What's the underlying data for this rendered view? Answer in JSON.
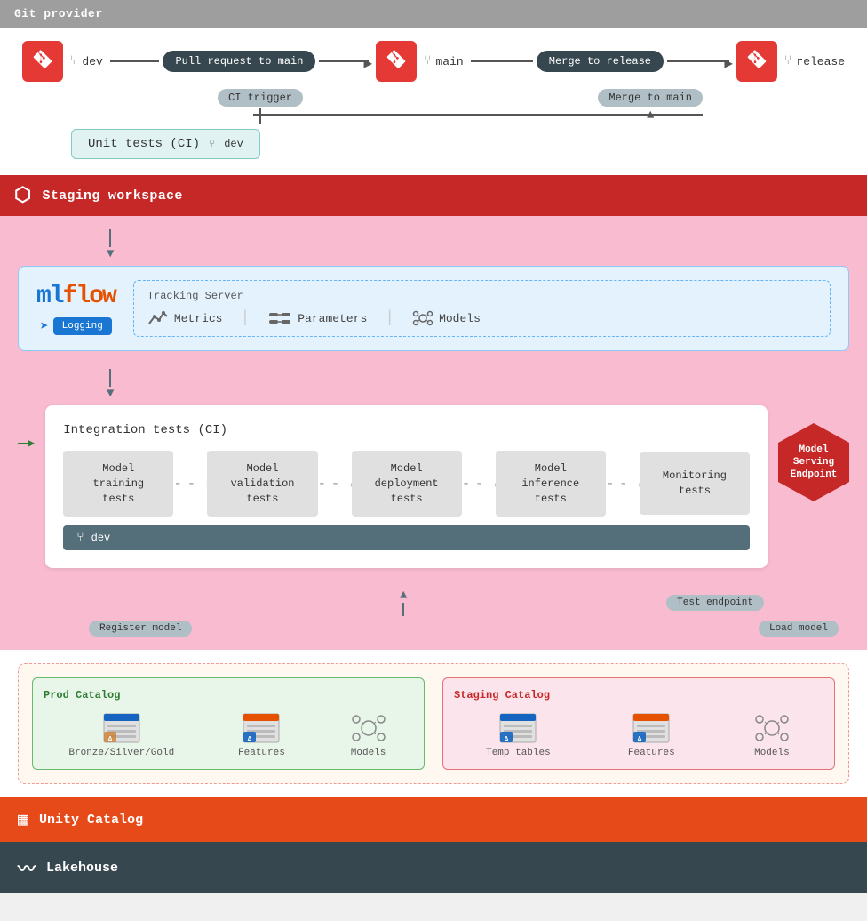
{
  "gitProviderBar": {
    "label": "Git provider"
  },
  "gitFlow": {
    "devBranch": "dev",
    "mainBranch": "main",
    "releaseBranch": "release",
    "pullRequestBtn": "Pull request to main",
    "mergeToReleaseBtn": "Merge to release",
    "ciTriggerLabel": "CI trigger",
    "mergeToMainLabel": "Merge to main"
  },
  "unitTests": {
    "label": "Unit tests (CI)",
    "branch": "dev"
  },
  "stagingWorkspace": {
    "label": "Staging workspace"
  },
  "mlflow": {
    "logo": "mlflow",
    "loggingBtn": "Logging",
    "trackingServer": {
      "title": "Tracking Server",
      "metrics": "Metrics",
      "parameters": "Parameters",
      "models": "Models"
    }
  },
  "integrationTests": {
    "title": "Integration tests (CI)",
    "tests": [
      {
        "label": "Model training tests"
      },
      {
        "label": "Model validation tests"
      },
      {
        "label": "Model deployment tests"
      },
      {
        "label": "Model inference tests"
      },
      {
        "label": "Monitoring tests"
      }
    ],
    "devLabel": "dev",
    "testEndpointLabel": "Test endpoint",
    "registerModelLabel": "Register model",
    "loadModelLabel": "Load model"
  },
  "modelServingEndpoint": {
    "label": "Model Serving Endpoint"
  },
  "prodCatalog": {
    "title": "Prod Catalog",
    "items": [
      {
        "label": "Bronze/Silver/Gold"
      },
      {
        "label": "Features"
      },
      {
        "label": "Models"
      }
    ]
  },
  "stagingCatalog": {
    "title": "Staging Catalog",
    "items": [
      {
        "label": "Temp tables"
      },
      {
        "label": "Features"
      },
      {
        "label": "Models"
      }
    ]
  },
  "unityCatalog": {
    "label": "Unity Catalog"
  },
  "lakehouse": {
    "label": "Lakehouse"
  },
  "colors": {
    "gitRed": "#e53935",
    "stagingDark": "#c62828",
    "teal": "#00897b",
    "blue": "#1976d2",
    "darkGrey": "#37474f",
    "orange": "#e64a19",
    "slateBlue": "#546e7a"
  }
}
